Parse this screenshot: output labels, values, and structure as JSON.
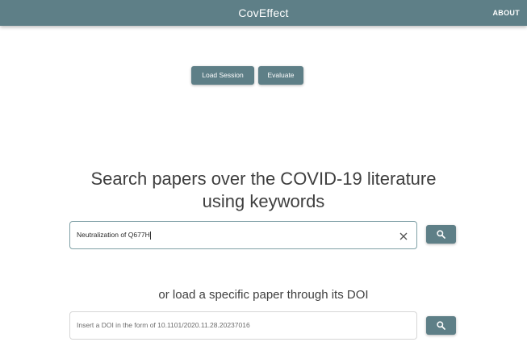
{
  "header": {
    "title": "CovEffect",
    "about_label": "ABOUT"
  },
  "actions": {
    "load_session_label": "Load Session",
    "evaluate_label": "Evaluate"
  },
  "keyword_search": {
    "headline_line1": "Search papers over the COVID-19 literature",
    "headline_line2": "using keywords",
    "value": "Neutralization of Q677H",
    "clear_icon": "close-icon",
    "search_icon": "search-icon"
  },
  "doi_search": {
    "headline": "or load a specific paper through its DOI",
    "placeholder": "Insert a DOI in the form of 10.1101/2020.11.28.20237016",
    "search_icon": "search-icon"
  },
  "colors": {
    "primary": "#5e7f87",
    "focused_border": "#7fa0a6"
  }
}
